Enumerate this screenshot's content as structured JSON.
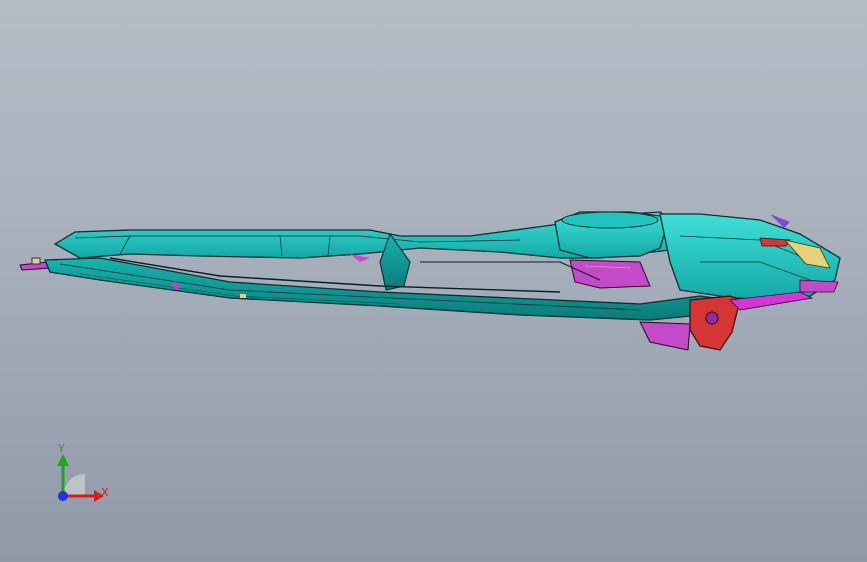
{
  "viewport": {
    "background_top": "#b6bcc6",
    "background_bottom": "#8f99a8"
  },
  "model": {
    "body_color": "#1fc7c0",
    "body_dark": "#0c7f80",
    "edge_color": "#0a2a2c",
    "accent_magenta": "#d436d6",
    "accent_red": "#d43636",
    "accent_yellow": "#e6d27a"
  },
  "triad": {
    "x_label": "X",
    "y_label": "Y",
    "x_color": "#d02020",
    "y_color": "#22a322",
    "z_color": "#1f34d6",
    "icon": "coordinate-triad-icon"
  }
}
